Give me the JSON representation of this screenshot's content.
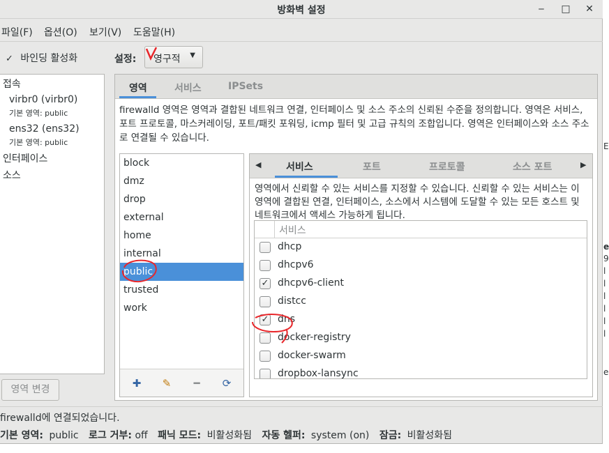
{
  "window": {
    "title": "방화벽 설정",
    "minimize": "‒",
    "maximize": "□",
    "close": "✕"
  },
  "menu": {
    "file": "파일(F)",
    "options": "옵션(O)",
    "view": "보기(V)",
    "help": "도움말(H)"
  },
  "left": {
    "toggle_icon": "✓",
    "bind_label": "바인딩 활성화",
    "connections": "접속",
    "conn1_name": "virbr0 (virbr0)",
    "conn1_zone": "기본 영역: public",
    "conn2_name": "ens32 (ens32)",
    "conn2_zone": "기본 영역: public",
    "interfaces": "인터페이스",
    "sources": "소스",
    "zone_change_button": "영역 변경"
  },
  "config": {
    "label": "설정:",
    "value": "영구적",
    "arrow": "▼"
  },
  "tabs": {
    "zones": "영역",
    "services": "서비스",
    "ipsets": "IPSets"
  },
  "zones_description": "firewalld 영역은 영역과 결합된 네트워크 연결, 인터페이스 및 소스 주소의 신뢰된 수준을 정의합니다. 영역은 서비스, 포트 프로토콜, 마스커레이딩, 포트/패킷 포워딩, icmp 필터 및 고급 규칙의 조합입니다. 영역은 인터페이스와 소스 주소로 연결될 수 있습니다.",
  "zones": [
    "block",
    "dmz",
    "drop",
    "external",
    "home",
    "internal",
    "public",
    "trusted",
    "work"
  ],
  "selected_zone": "public",
  "zone_toolbar": {
    "add": "✚",
    "edit": "✎",
    "remove": "━",
    "load_defaults": "⟳"
  },
  "inner_tabs": {
    "left_arrow": "◀",
    "services": "서비스",
    "ports": "포트",
    "protocols": "프로토콜",
    "source_ports": "소스 포트",
    "right_arrow": "▶"
  },
  "services_description": "영역에서 신뢰할 수 있는 서비스를 지정할 수 있습니다. 신뢰할 수 있는 서비스는 이 영역에 결합된 연결, 인터페이스, 소스에서 시스템에 도달할 수 있는 모든 호스트 및 네트워크에서 액세스 가능하게 됩니다.",
  "services_header": "서비스",
  "services": [
    {
      "name": "dhcp",
      "checked": false
    },
    {
      "name": "dhcpv6",
      "checked": false
    },
    {
      "name": "dhcpv6-client",
      "checked": true
    },
    {
      "name": "distcc",
      "checked": false
    },
    {
      "name": "dns",
      "checked": true
    },
    {
      "name": "docker-registry",
      "checked": false
    },
    {
      "name": "docker-swarm",
      "checked": false
    },
    {
      "name": "dropbox-lansync",
      "checked": false
    }
  ],
  "status": {
    "connected": "firewalld에 연결되었습니다.",
    "default_zone_label": "기본 영역:",
    "default_zone_value": "public",
    "log_denied_label": "로그 거부:",
    "log_denied_value": "off",
    "panic_label": "패닉 모드:",
    "panic_value": "비활성화됨",
    "auto_helper_label": "자동 헬퍼:",
    "auto_helper_value": "system (on)",
    "lock_label": "잠금:",
    "lock_value": "비활성화됨"
  },
  "colors": {
    "accent": "#4a90d9",
    "annotation": "#e8262a"
  }
}
